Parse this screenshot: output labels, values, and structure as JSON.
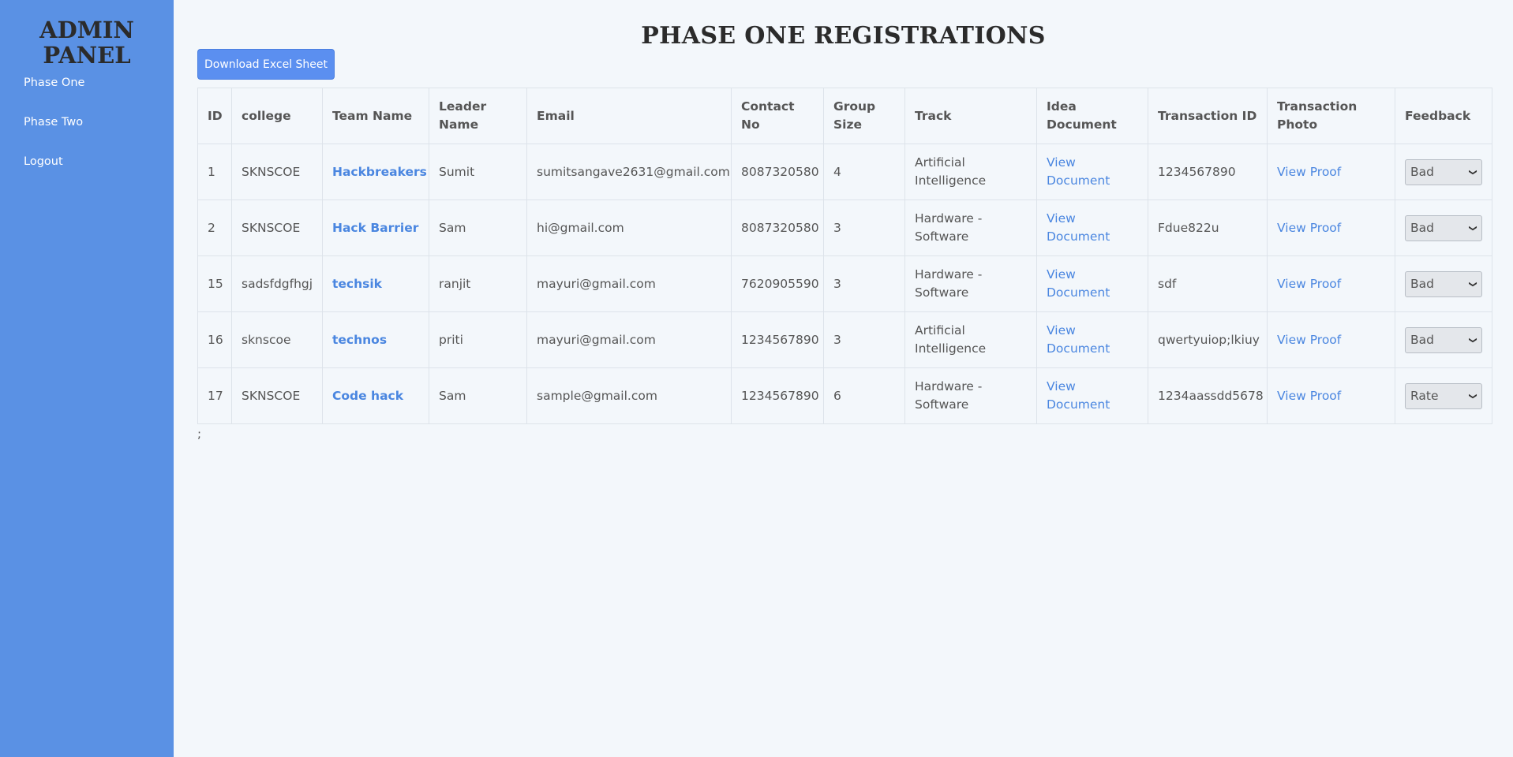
{
  "sidebar": {
    "title_line1": "ADMIN",
    "title_line2": "PANEL",
    "items": [
      {
        "label": "Phase One"
      },
      {
        "label": "Phase Two"
      },
      {
        "label": "Logout"
      }
    ]
  },
  "main": {
    "title": "PHASE ONE REGISTRATIONS",
    "download_label": "Download Excel Sheet",
    "trailing_text": ";"
  },
  "table": {
    "headers": [
      "ID",
      "college",
      "Team Name",
      "Leader Name",
      "Email",
      "Contact No",
      "Group Size",
      "Track",
      "Idea Document",
      "Transaction ID",
      "Transaction Photo",
      "Feedback"
    ],
    "rows": [
      {
        "id": "1",
        "college": "SKNSCOE",
        "team": "Hackbreakers",
        "leader": "Sumit",
        "email": "sumitsangave2631@gmail.com",
        "contact": "8087320580",
        "size": "4",
        "track": "Artificial Intelligence",
        "doc": "View Document",
        "txn": "1234567890",
        "photo": "View Proof",
        "feedback": "Bad"
      },
      {
        "id": "2",
        "college": "SKNSCOE",
        "team": "Hack Barrier",
        "leader": "Sam",
        "email": "hi@gmail.com",
        "contact": "8087320580",
        "size": "3",
        "track": "Hardware - Software",
        "doc": "View Document",
        "txn": "Fdue822u",
        "photo": "View Proof",
        "feedback": "Bad"
      },
      {
        "id": "15",
        "college": "sadsfdgfhgj",
        "team": "techsik",
        "leader": "ranjit",
        "email": "mayuri@gmail.com",
        "contact": "7620905590",
        "size": "3",
        "track": "Hardware - Software",
        "doc": "View Document",
        "txn": "sdf",
        "photo": "View Proof",
        "feedback": "Bad"
      },
      {
        "id": "16",
        "college": "sknscoe",
        "team": "technos",
        "leader": "priti",
        "email": "mayuri@gmail.com",
        "contact": "1234567890",
        "size": "3",
        "track": "Artificial Intelligence",
        "doc": "View Document",
        "txn": "qwertyuiop;lkiuy",
        "photo": "View Proof",
        "feedback": "Bad"
      },
      {
        "id": "17",
        "college": "SKNSCOE",
        "team": "Code hack",
        "leader": "Sam",
        "email": "sample@gmail.com",
        "contact": "1234567890",
        "size": "6",
        "track": "Hardware - Software",
        "doc": "View Document",
        "txn": "1234aassdd5678",
        "photo": "View Proof",
        "feedback": "Rate"
      }
    ]
  },
  "colors": {
    "sidebar_bg": "#5a91e4",
    "page_bg": "#f3f7fb",
    "link": "#4a86e0",
    "button_bg": "#5b8ff0"
  }
}
